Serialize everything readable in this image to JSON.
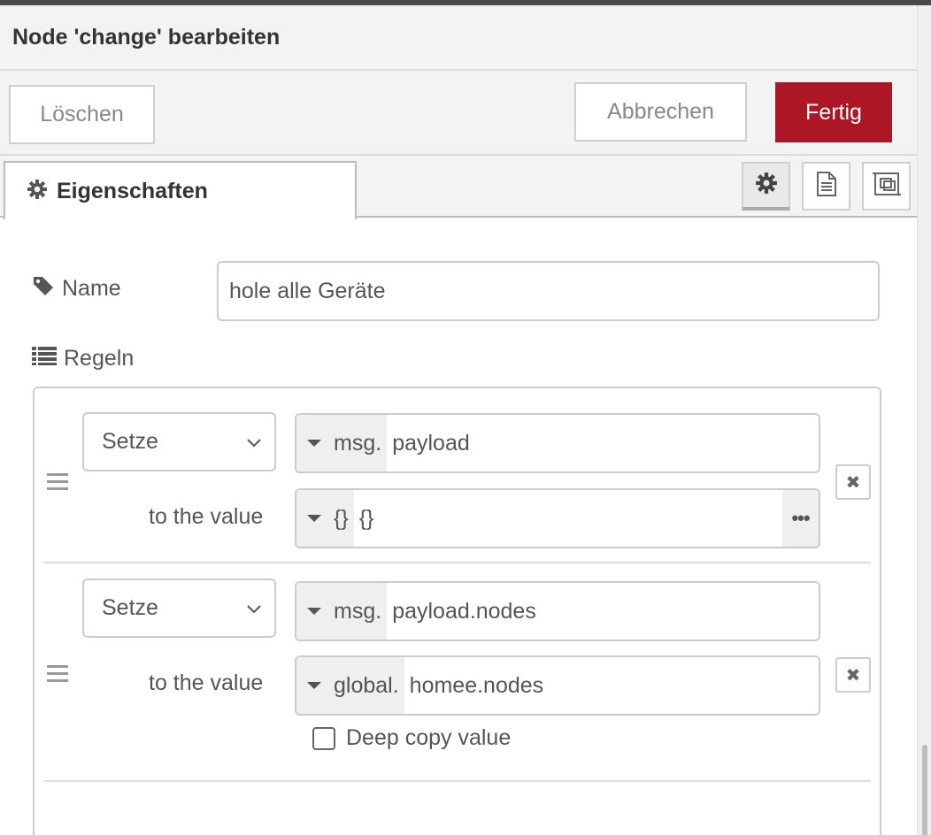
{
  "dialog": {
    "title": "Node 'change' bearbeiten"
  },
  "toolbar": {
    "delete_label": "Löschen",
    "cancel_label": "Abbrechen",
    "done_label": "Fertig",
    "done_color": "#ad1625"
  },
  "tabs": {
    "properties_label": "Eigenschaften",
    "buttons": [
      "gear-icon",
      "document-icon",
      "frame-icon"
    ]
  },
  "form": {
    "name_label": "Name",
    "name_value": "hole alle Geräte",
    "rules_label": "Regeln"
  },
  "rules": [
    {
      "action": "Setze",
      "target_type": "msg.",
      "target_value": "payload",
      "to_label": "to the value",
      "value_type": "{}",
      "value": "{}",
      "expand": "•••"
    },
    {
      "action": "Setze",
      "target_type": "msg.",
      "target_value": "payload.nodes",
      "to_label": "to the value",
      "value_type": "global.",
      "value": "homee.nodes",
      "deep_copy_label": "Deep copy value",
      "deep_copy_checked": false
    }
  ],
  "remove_glyph": "✖"
}
